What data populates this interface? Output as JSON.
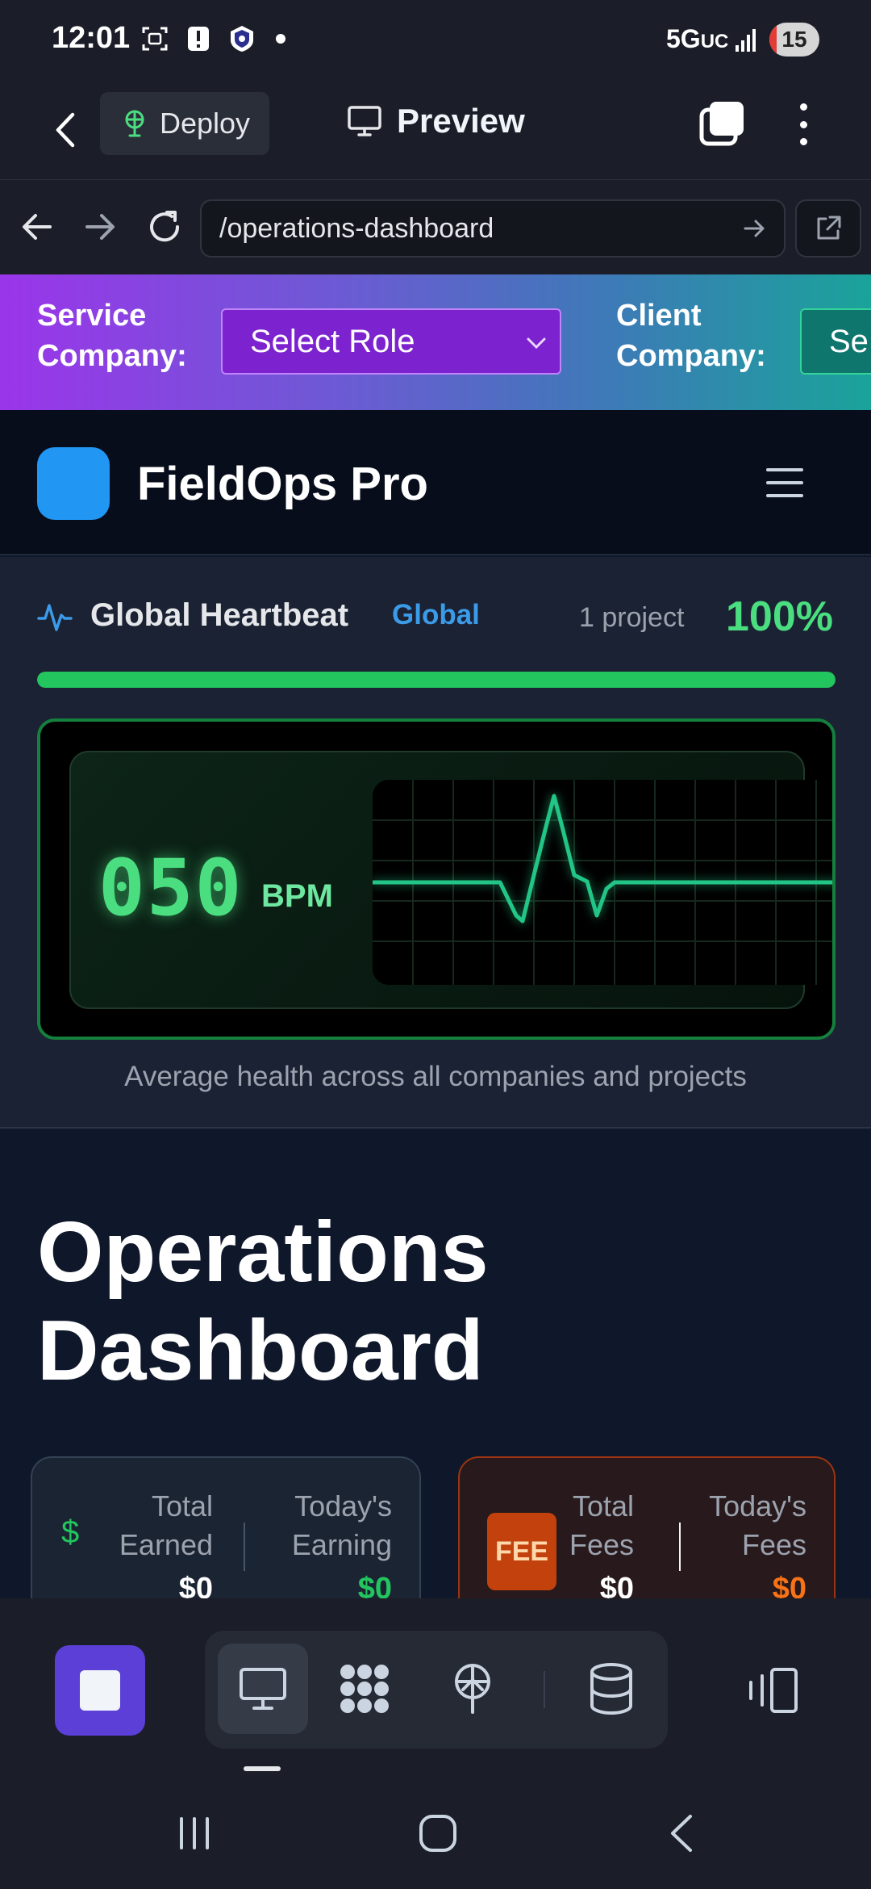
{
  "status_bar": {
    "time": "12:01",
    "network": "5G",
    "network_suffix": "UC",
    "battery": "15",
    "battery_level": 0.15,
    "icons": [
      "screenshot-icon",
      "alert-icon",
      "shield-app-icon",
      "notification-dot"
    ]
  },
  "editor_bar": {
    "deploy_label": "Deploy",
    "preview_label": "Preview"
  },
  "url_bar": {
    "url": "/operations-dashboard"
  },
  "role_banner": {
    "service_label_line1": "Service",
    "service_label_line2": "Company:",
    "service_select": "Select Role",
    "client_label_line1": "Client",
    "client_label_line2": "Company:",
    "client_select": "Se"
  },
  "app_header": {
    "title": "FieldOps Pro",
    "logo_color": "#2196f3"
  },
  "heartbeat": {
    "title": "Global Heartbeat",
    "scope": "Global",
    "projects": "1 project",
    "health_percent": "100%",
    "health_fraction": 1.0,
    "bpm": "050",
    "bpm_unit": "BPM",
    "caption": "Average health across all companies and projects",
    "accent_color": "#4ade80"
  },
  "dashboard": {
    "title_line1": "Operations",
    "title_line2": "Dashboard",
    "earnings_card": {
      "total_label_line1": "Total",
      "total_label_line2": "Earned",
      "total_value": "$0",
      "today_label_line1": "Today's",
      "today_label_line2": "Earning",
      "today_value": "$0",
      "icon_glyph": "$"
    },
    "fees_card": {
      "badge": "FEE",
      "total_label_line1": "Total",
      "total_label_line2": "Fees",
      "total_value": "$0",
      "today_label_line1": "Today's",
      "today_label_line2": "Fees",
      "today_value": "$0"
    }
  },
  "dock": {
    "items": [
      "monitor-icon",
      "apps-grid-icon",
      "deploy-tower-icon",
      "database-icon"
    ],
    "active_item": "monitor-icon"
  }
}
